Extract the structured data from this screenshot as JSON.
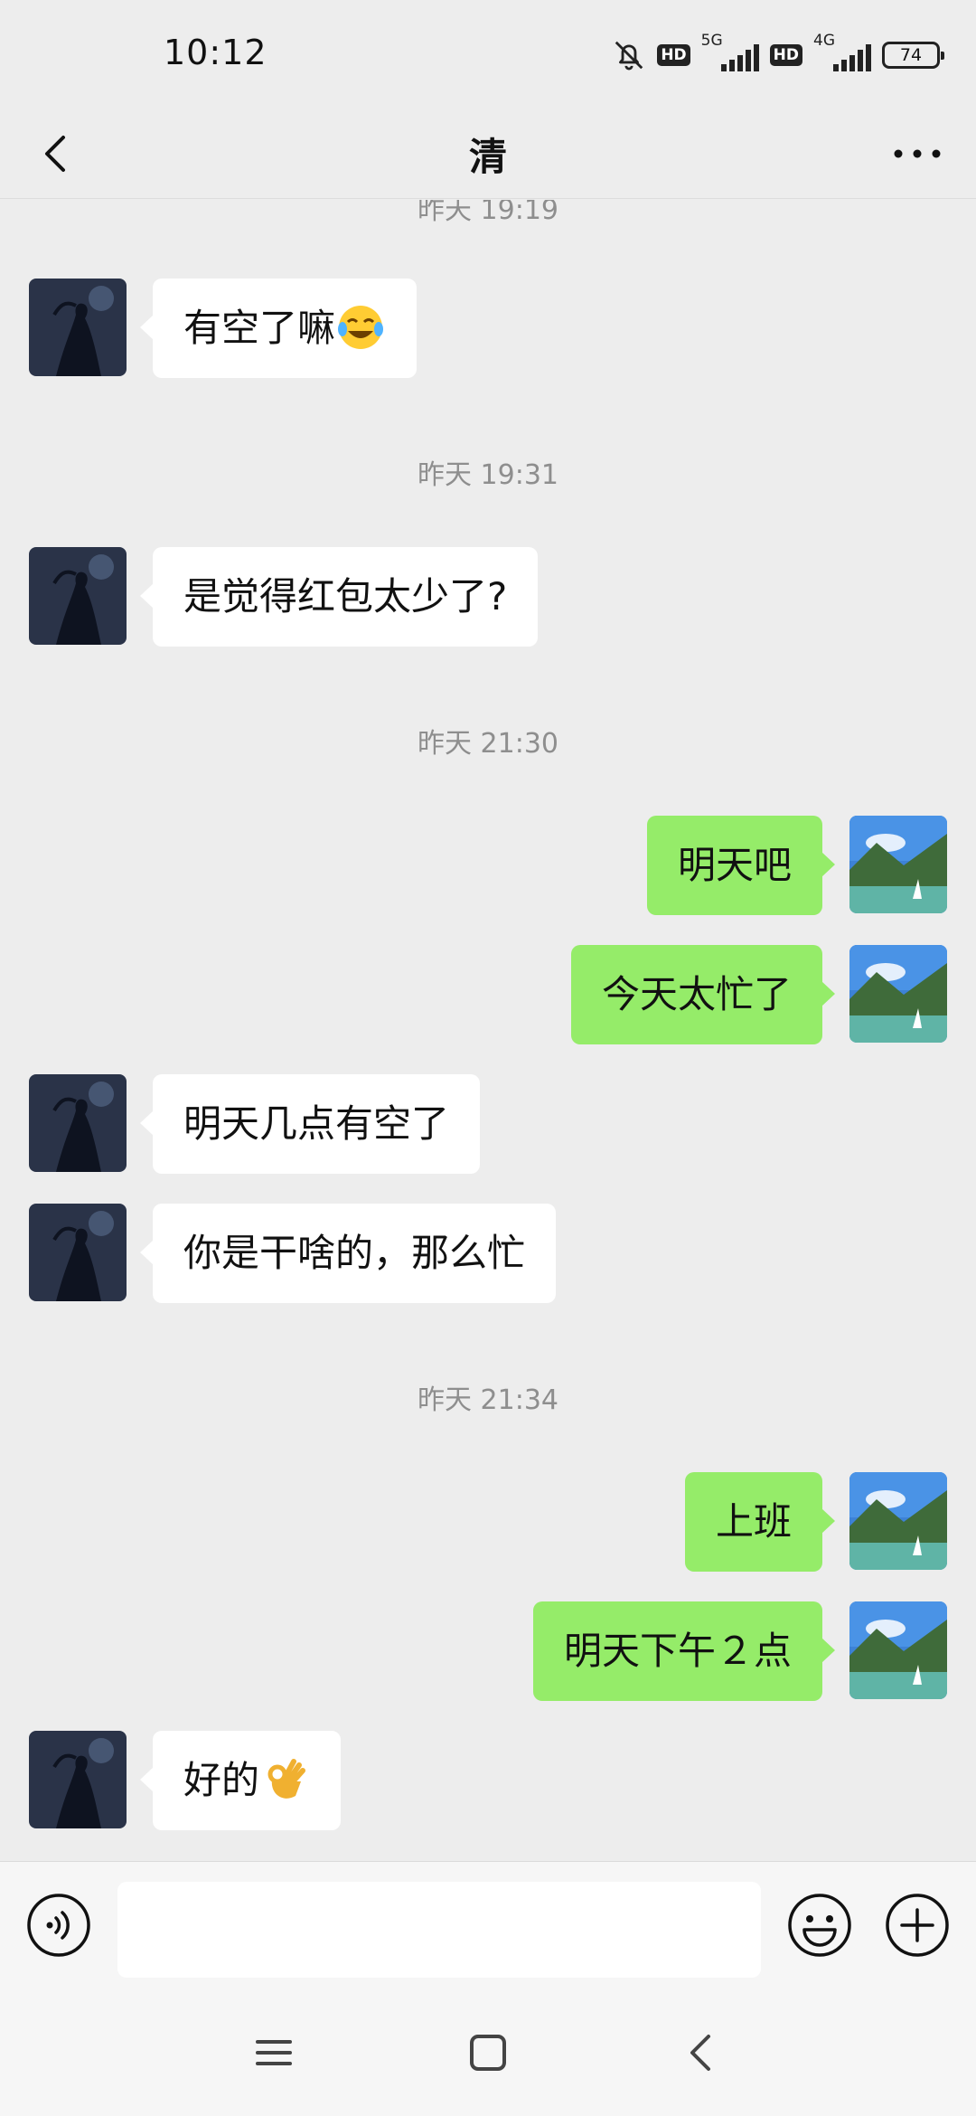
{
  "status_bar": {
    "time": "10:12",
    "hd_label": "HD",
    "network_5g": "5G",
    "network_4g": "4G",
    "battery": "74"
  },
  "header": {
    "title": "清"
  },
  "messages": [
    {
      "kind": "timestamp",
      "text": "昨天 19:19"
    },
    {
      "kind": "incoming",
      "text": "有空了嘛",
      "emoji": "tears-of-joy-emoji"
    },
    {
      "kind": "timestamp",
      "text": "昨天 19:31"
    },
    {
      "kind": "incoming",
      "text": "是觉得红包太少了?"
    },
    {
      "kind": "timestamp",
      "text": "昨天 21:30"
    },
    {
      "kind": "outgoing",
      "text": "明天吧"
    },
    {
      "kind": "outgoing",
      "text": "今天太忙了"
    },
    {
      "kind": "incoming",
      "text": "明天几点有空了"
    },
    {
      "kind": "incoming",
      "text": "你是干啥的，那么忙"
    },
    {
      "kind": "timestamp",
      "text": "昨天 21:34"
    },
    {
      "kind": "outgoing",
      "text": "上班"
    },
    {
      "kind": "outgoing",
      "text": "明天下午２点"
    },
    {
      "kind": "incoming",
      "text": "好的",
      "emoji": "ok-hand-emoji"
    }
  ],
  "input": {
    "value": "",
    "placeholder": ""
  },
  "icons": {
    "back": "back-arrow-icon",
    "more": "more-dots-icon",
    "voice": "voice-icon",
    "emoji": "emoji-icon",
    "plus": "plus-icon",
    "nav_menu": "menu-icon",
    "nav_home": "home-icon",
    "nav_back": "back-icon"
  },
  "colors": {
    "background": "#ededed",
    "outgoing_bubble": "#95ec69",
    "incoming_bubble": "#ffffff",
    "timestamp": "#8e8e8e"
  }
}
